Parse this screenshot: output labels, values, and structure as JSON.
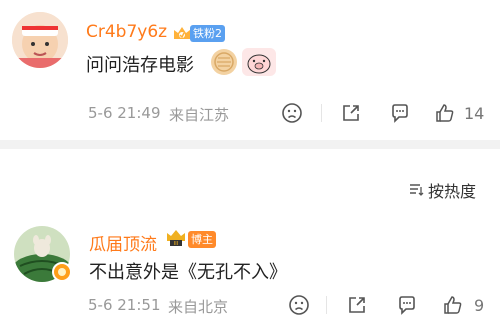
{
  "comments": [
    {
      "username": "Cr4b7y6z",
      "badge": "铁粉2",
      "text": "问问浩存电影",
      "time": "5-6 21:49",
      "location": "来自江苏",
      "like_count": "14"
    },
    {
      "username": "瓜届顶流",
      "badge": "博主",
      "text": "不出意外是《无孔不入》",
      "time": "5-6 21:51",
      "location": "来自北京",
      "like_count": "9"
    }
  ],
  "sort": {
    "label": "按热度"
  },
  "colors": {
    "username": "#ff7a1a",
    "fan_badge": "#5aa0f0",
    "author_badge": "#ff8a2a"
  },
  "icons": [
    "sad-emoji-icon",
    "share-icon",
    "comment-icon",
    "like-icon",
    "sort-icon"
  ]
}
